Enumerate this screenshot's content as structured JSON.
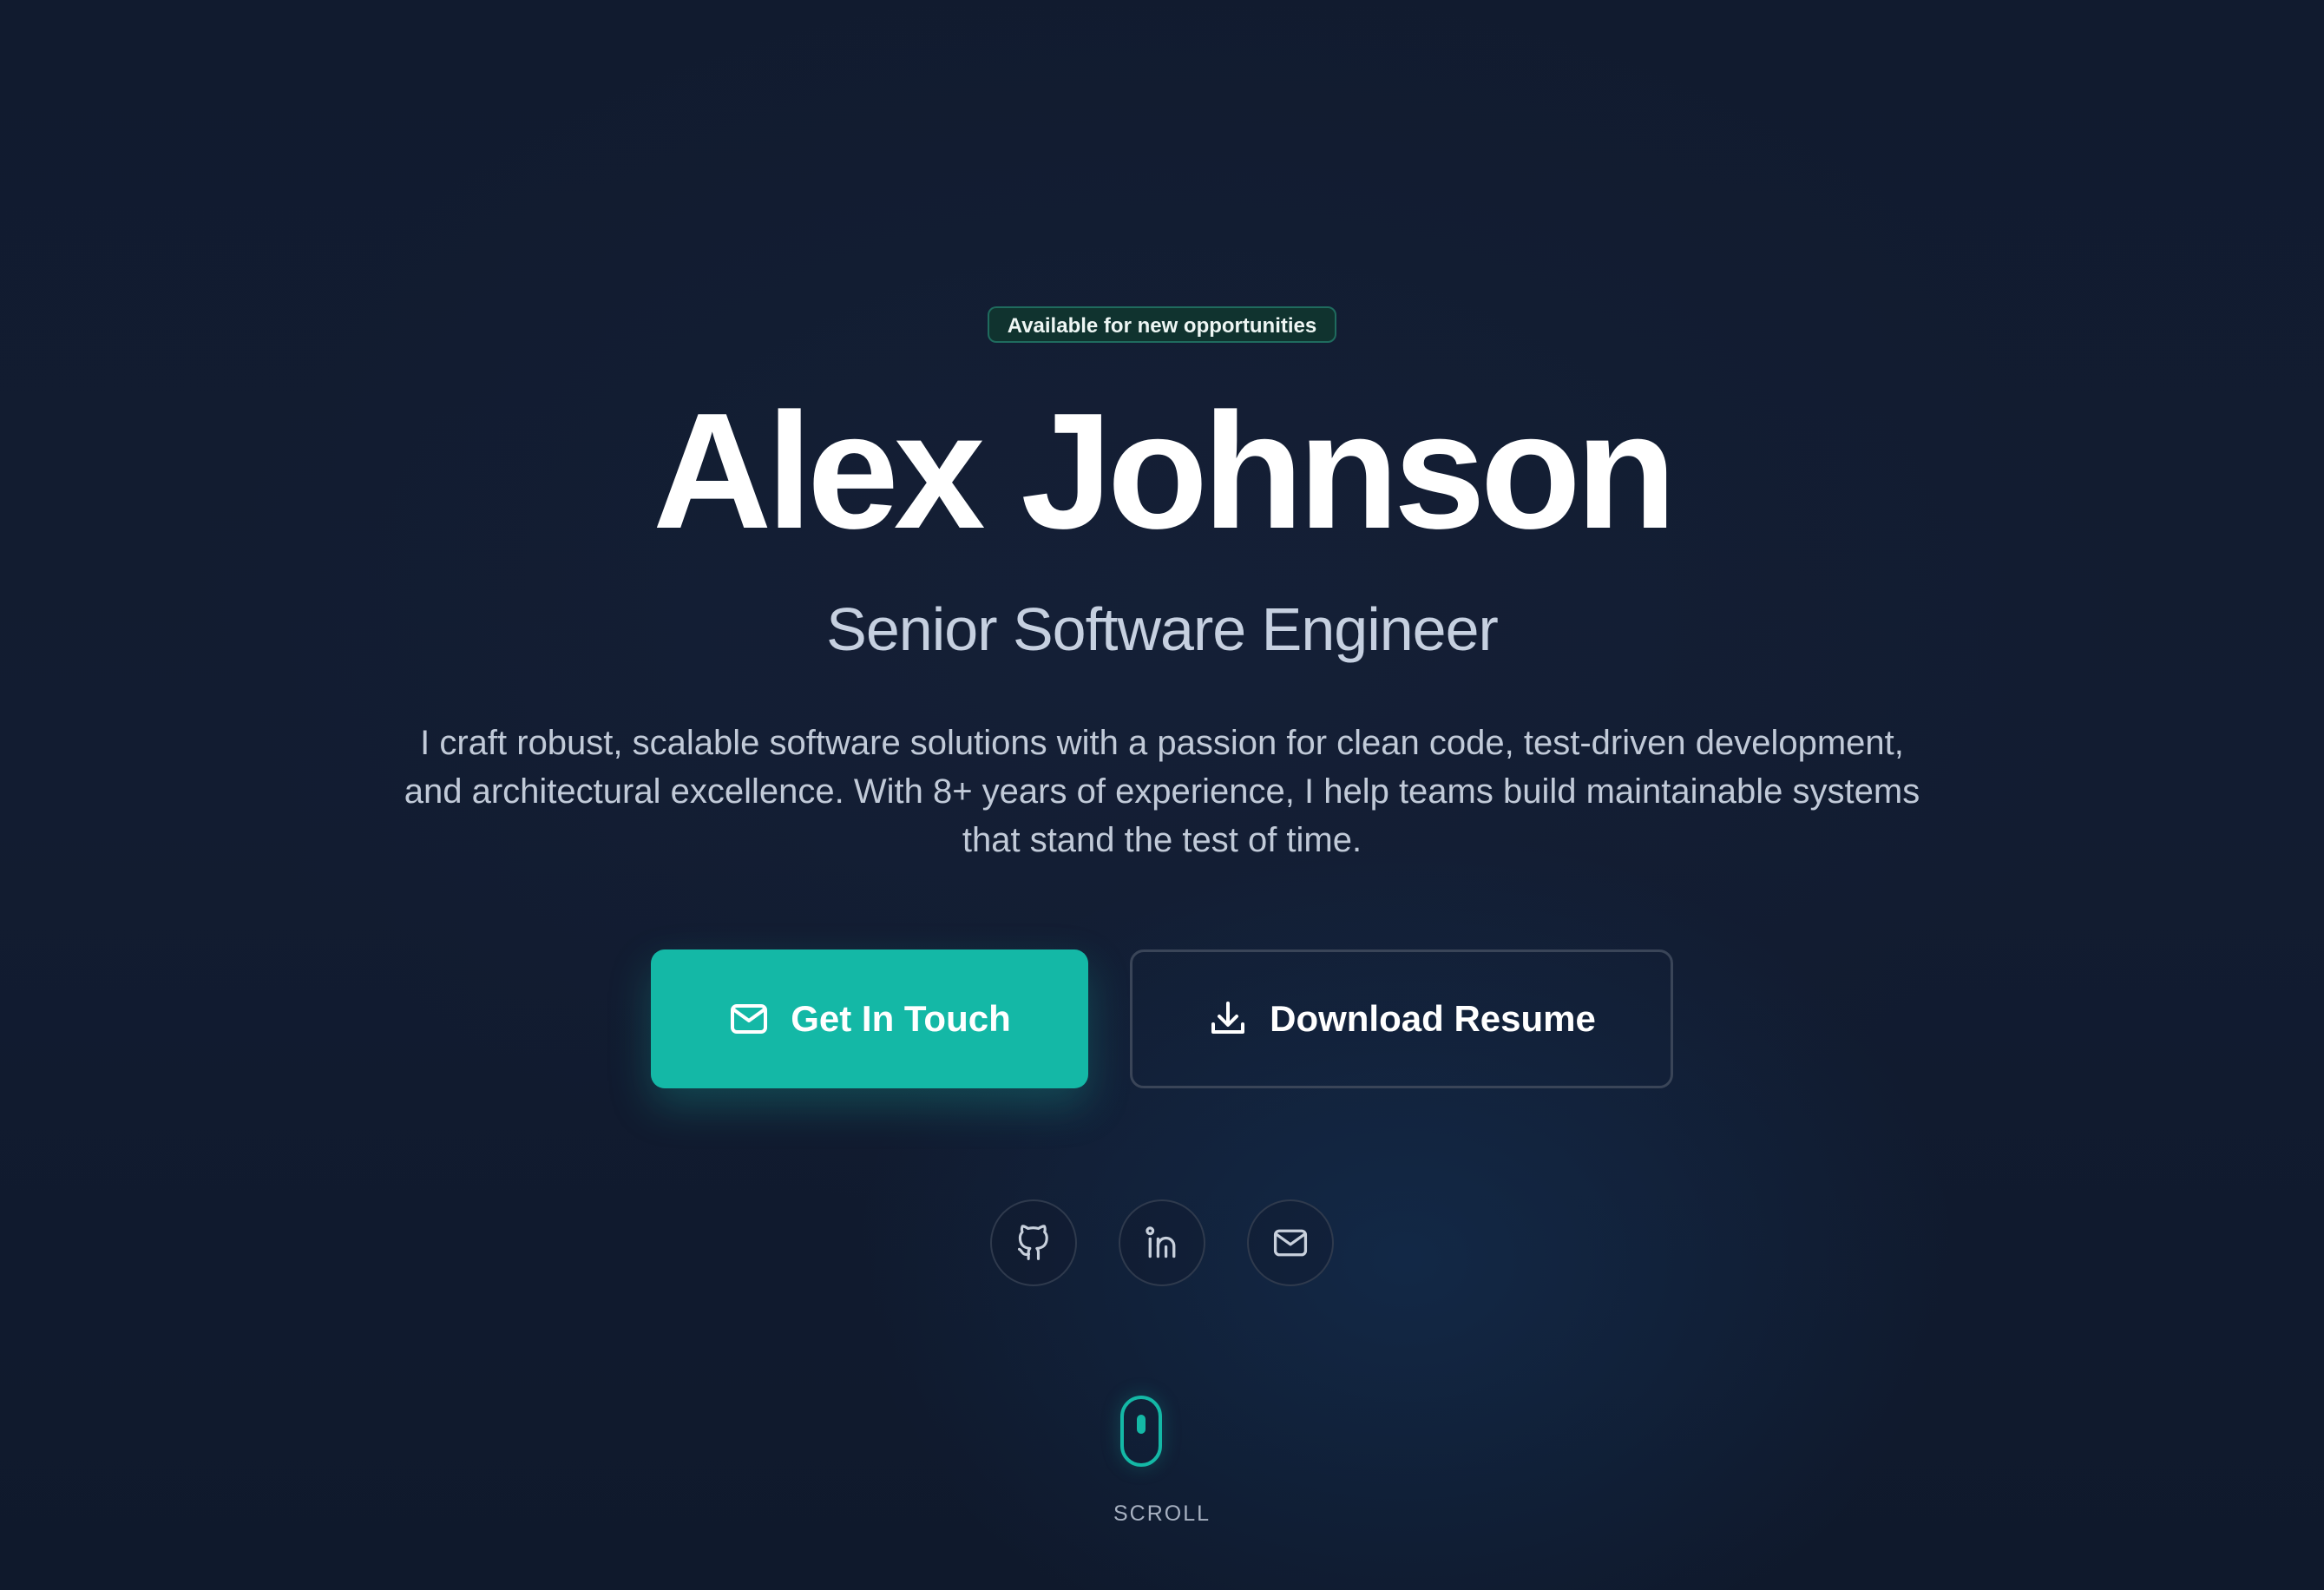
{
  "badge": {
    "text": "Available for new opportunities"
  },
  "hero": {
    "name": "Alex Johnson",
    "role": "Senior Software Engineer",
    "bio": "I craft robust, scalable software solutions with a passion for clean code, test-driven development, and architectural excellence. With 8+ years of experience, I help teams build maintainable systems that stand the test of time."
  },
  "actions": {
    "primary": {
      "label": "Get In Touch",
      "icon": "mail-icon"
    },
    "secondary": {
      "label": "Download Resume",
      "icon": "download-icon"
    }
  },
  "socials": [
    {
      "icon": "github-icon"
    },
    {
      "icon": "linkedin-icon"
    },
    {
      "icon": "mail-icon"
    }
  ],
  "scroll": {
    "label": "SCROLL",
    "icon": "mouse-icon"
  },
  "colors": {
    "background": "#111a2e",
    "accent": "#14b8a6",
    "badge_bg": "#10332f",
    "badge_border": "#1f6b5e",
    "heading": "#ffffff",
    "subheading": "#c6d0e0",
    "body_text": "#c1cad8",
    "outline": "#3a4558"
  }
}
